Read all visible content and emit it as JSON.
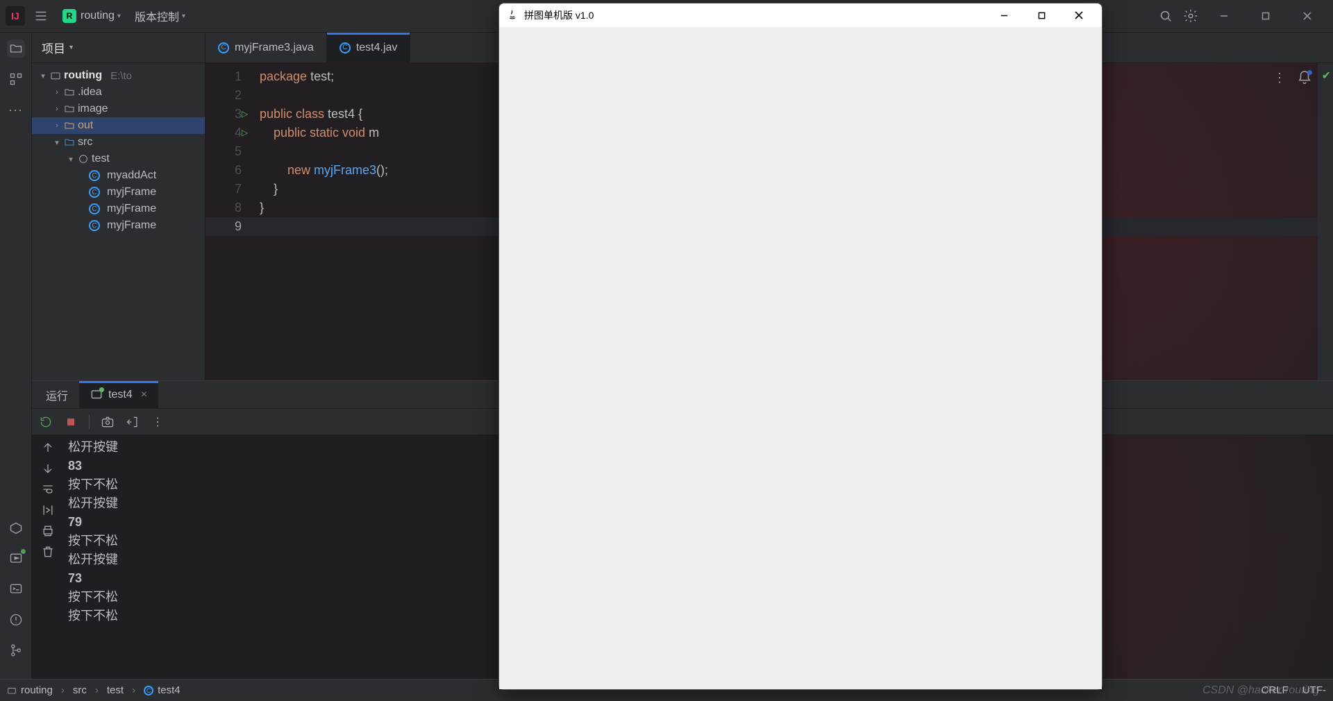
{
  "titlebar": {
    "project_badge": "R",
    "project_name": "routing",
    "vcs_menu": "版本控制"
  },
  "sidebar": {
    "header": "项目",
    "root": "routing",
    "root_path": "E:\\to",
    "folders": {
      "idea": ".idea",
      "image": "image",
      "out": "out",
      "src": "src",
      "test": "test"
    },
    "classes": [
      "myaddAct",
      "myjFrame",
      "myjFrame",
      "myjFrame"
    ]
  },
  "tabs": {
    "tab1": "myjFrame3.java",
    "tab2": "test4.jav"
  },
  "code": {
    "lines": [
      "1",
      "2",
      "3",
      "4",
      "5",
      "6",
      "7",
      "8",
      "9"
    ],
    "l1a": "package",
    "l1b": " test;",
    "l3a": "public class",
    "l3b": " test4 ",
    "l3c": "{",
    "l4a": "    public static void",
    "l4b": " m",
    "l6a": "        new",
    "l6b": " myjFrame3",
    "l6c": "();",
    "l7": "    }",
    "l8": "}"
  },
  "run": {
    "label": "运行",
    "tab_name": "test4",
    "console": [
      "松开按键",
      "83",
      "按下不松",
      "松开按键",
      "79",
      "按下不松",
      "松开按键",
      "73",
      "按下不松",
      "按下不松"
    ]
  },
  "breadcrumb": {
    "p1": "routing",
    "p2": "src",
    "p3": "test",
    "p4": "test4"
  },
  "status": {
    "crlf": "CRLF",
    "enc": "UTF-"
  },
  "watermark": "CSDN @hacker-routing",
  "java_window": {
    "title": "拼图单机版 v1.0"
  }
}
